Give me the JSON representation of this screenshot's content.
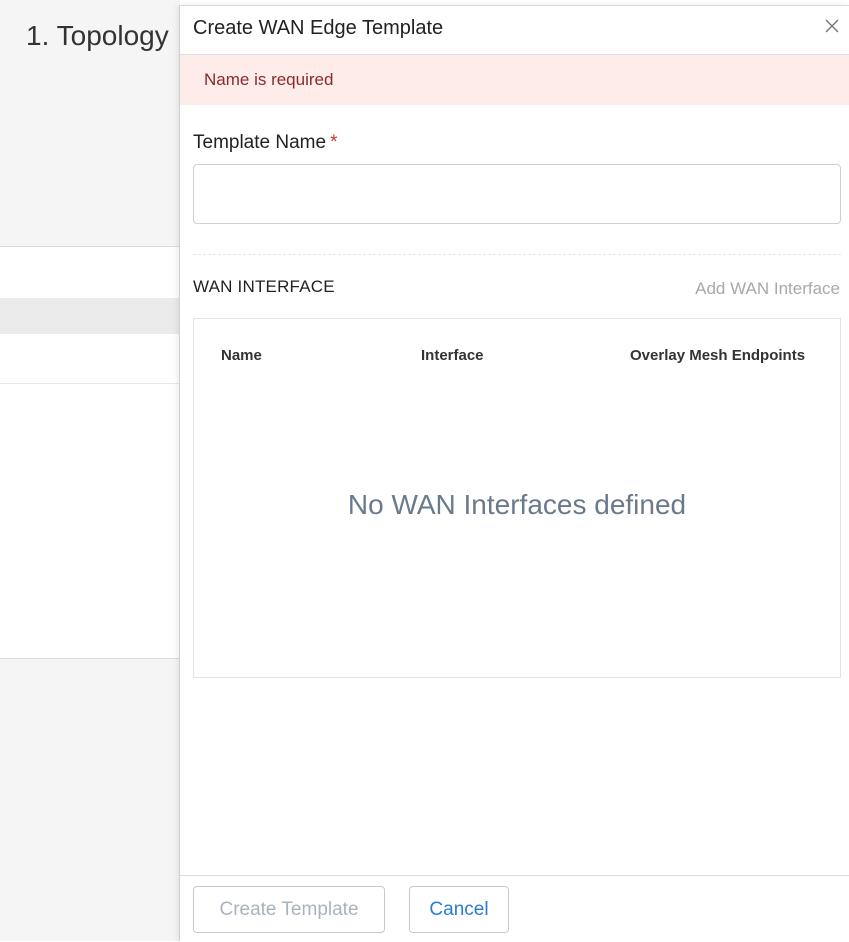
{
  "background": {
    "step_title": "1. Topology"
  },
  "drawer": {
    "title": "Create WAN Edge Template",
    "close_icon": "close-icon",
    "error_message": "Name is required",
    "template_name": {
      "label": "Template Name",
      "required_mark": "*",
      "value": "",
      "placeholder": ""
    },
    "wan_interface": {
      "section_title": "WAN INTERFACE",
      "add_link": "Add WAN Interface",
      "columns": [
        "Name",
        "Interface",
        "Overlay Mesh Endpoints"
      ],
      "empty_message": "No WAN Interfaces defined"
    },
    "footer": {
      "create_label": "Create Template",
      "cancel_label": "Cancel"
    }
  },
  "colors": {
    "error_bg": "#fdecea",
    "error_text": "#8a2a2a",
    "required": "#d0342c",
    "link_blue": "#2b7bd6",
    "disabled_text": "#a9b3bd",
    "empty_text": "#6a7a8c"
  }
}
